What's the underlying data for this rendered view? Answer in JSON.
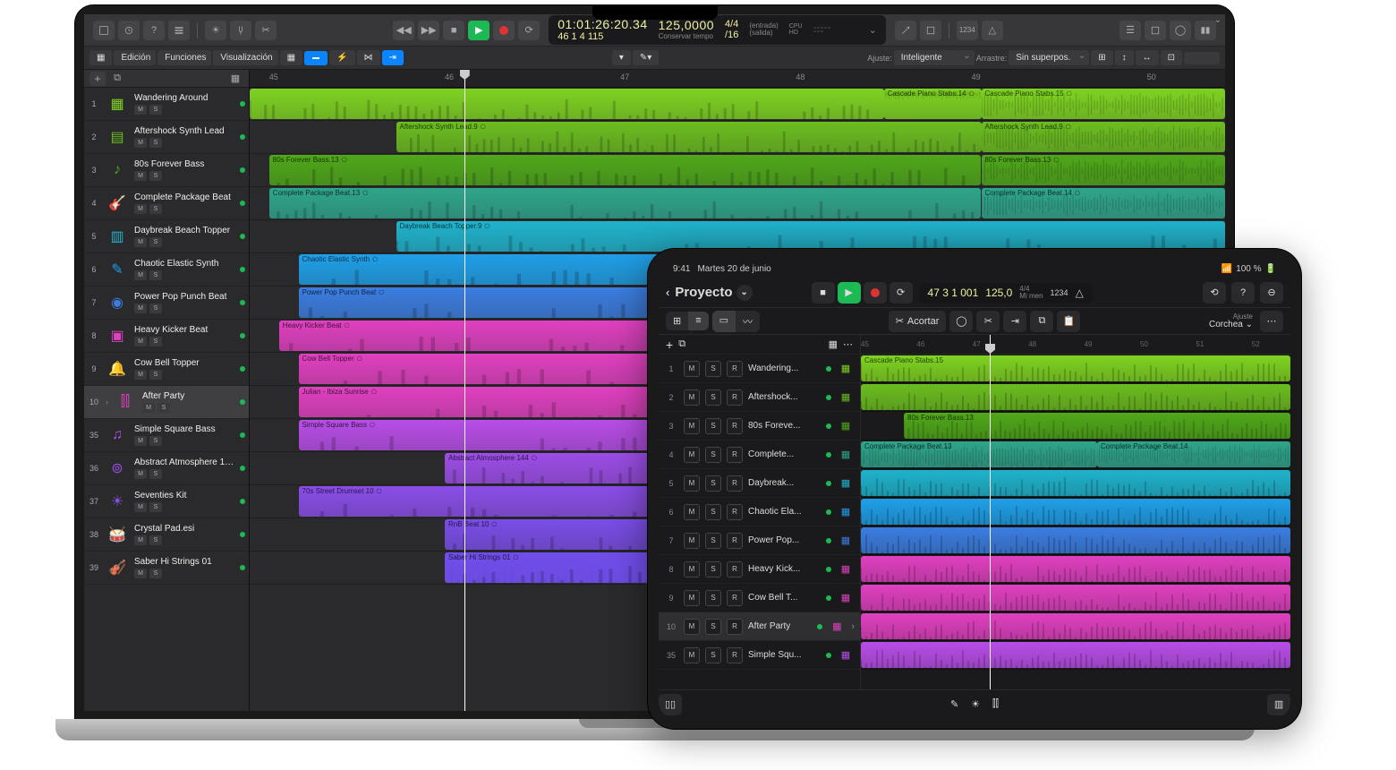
{
  "mac": {
    "toolbar": {
      "transport_lcd": {
        "timecode": "01:01:26:20.34",
        "position": "46 1 4 115",
        "tempo": "125,0000",
        "tempo_label": "Conservar tempo",
        "sig": "4/4",
        "sig_div": "/16",
        "in_label": "(entrada)",
        "out_label": "(salida)",
        "cpu": "CPU",
        "hd": "HD"
      },
      "right_label": "1234"
    },
    "menubar": {
      "edit": "Edición",
      "functions": "Funciones",
      "view": "Visualización",
      "snap_label": "Ajuste:",
      "snap_value": "Inteligente",
      "drag_label": "Arrastre:",
      "drag_value": "Sin superpos."
    },
    "ruler_marks": [
      "45",
      "46",
      "47",
      "48",
      "49",
      "50"
    ],
    "tracks": [
      {
        "num": "1",
        "name": "Wandering Around",
        "color": "#7ed321",
        "icon": "grid"
      },
      {
        "num": "2",
        "name": "Aftershock Synth Lead",
        "color": "#6bbd1f",
        "icon": "synth"
      },
      {
        "num": "3",
        "name": "80s Forever Bass",
        "color": "#4fa819",
        "icon": "bass"
      },
      {
        "num": "4",
        "name": "Complete Package Beat",
        "color": "#2fa58b",
        "icon": "guitar"
      },
      {
        "num": "5",
        "name": "Daybreak Beach Topper",
        "color": "#1fb3cc",
        "icon": "synth2"
      },
      {
        "num": "6",
        "name": "Chaotic Elastic Synth",
        "color": "#1f9fe8",
        "icon": "pencil"
      },
      {
        "num": "7",
        "name": "Power Pop Punch Beat",
        "color": "#3b7de0",
        "icon": "beat"
      },
      {
        "num": "8",
        "name": "Heavy Kicker Beat",
        "color": "#e040c0",
        "icon": "kick"
      },
      {
        "num": "9",
        "name": "Cow Bell Topper",
        "color": "#e040c0",
        "icon": "bell"
      },
      {
        "num": "10",
        "name": "After Party",
        "color": "#e040c0",
        "icon": "party",
        "selected": true
      },
      {
        "num": "35",
        "name": "Simple Square Bass",
        "color": "#b84de8",
        "icon": "sqbass"
      },
      {
        "num": "36",
        "name": "Abstract Atmosphere 144",
        "color": "#9c4de8",
        "icon": "atmo"
      },
      {
        "num": "37",
        "name": "Seventies Kit",
        "color": "#8a4de8",
        "icon": "kit"
      },
      {
        "num": "38",
        "name": "Crystal Pad.esi",
        "color": "#7a4de8",
        "icon": "drum"
      },
      {
        "num": "39",
        "name": "Saber Hi Strings 01",
        "color": "#6f4de8",
        "icon": "strings"
      }
    ],
    "regions": [
      {
        "lane": 0,
        "start": 0,
        "end": 65,
        "label": "",
        "color": "#7ed321"
      },
      {
        "lane": 0,
        "start": 65,
        "end": 75,
        "label": "Cascade Piano Stabs.14",
        "color": "#7ed321"
      },
      {
        "lane": 0,
        "start": 75,
        "end": 100,
        "label": "Cascade Piano Stabs.15",
        "color": "#7ed321"
      },
      {
        "lane": 1,
        "start": 15,
        "end": 75,
        "label": "Aftershock Synth Lead.9",
        "color": "#6bbd1f"
      },
      {
        "lane": 1,
        "start": 75,
        "end": 100,
        "label": "Aftershock Synth Lead.9",
        "color": "#6bbd1f"
      },
      {
        "lane": 2,
        "start": 2,
        "end": 75,
        "label": "80s Forever Bass.13",
        "color": "#4fa819"
      },
      {
        "lane": 2,
        "start": 75,
        "end": 100,
        "label": "80s Forever Bass.13",
        "color": "#4fa819"
      },
      {
        "lane": 3,
        "start": 2,
        "end": 75,
        "label": "Complete Package Beat.13",
        "color": "#2fa58b"
      },
      {
        "lane": 3,
        "start": 75,
        "end": 100,
        "label": "Complete Package Beat.14",
        "color": "#2fa58b"
      },
      {
        "lane": 4,
        "start": 15,
        "end": 100,
        "label": "Daybreak Beach Topper.9",
        "color": "#1fb3cc"
      },
      {
        "lane": 5,
        "start": 5,
        "end": 100,
        "label": "Chaotic Elastic Synth",
        "color": "#1f9fe8"
      },
      {
        "lane": 6,
        "start": 5,
        "end": 100,
        "label": "Power Pop Punch Beat",
        "color": "#3b7de0"
      },
      {
        "lane": 7,
        "start": 3,
        "end": 100,
        "label": "Heavy Kicker Beat",
        "color": "#e040c0"
      },
      {
        "lane": 8,
        "start": 5,
        "end": 100,
        "label": "Cow Bell Topper",
        "color": "#e040c0"
      },
      {
        "lane": 9,
        "start": 5,
        "end": 100,
        "label": "Julian - Ibiza Sunrise",
        "color": "#e040c0"
      },
      {
        "lane": 10,
        "start": 5,
        "end": 100,
        "label": "Simple Square Bass",
        "color": "#b84de8"
      },
      {
        "lane": 11,
        "start": 20,
        "end": 100,
        "label": "Abstract Atmosphere 144",
        "color": "#9c4de8"
      },
      {
        "lane": 12,
        "start": 5,
        "end": 100,
        "label": "70s Street Drumset 10",
        "color": "#8a4de8"
      },
      {
        "lane": 13,
        "start": 20,
        "end": 100,
        "label": "RnB Beat 10",
        "color": "#7a4de8"
      },
      {
        "lane": 14,
        "start": 20,
        "end": 75,
        "label": "Saber Hi Strings 01",
        "color": "#6f4de8"
      },
      {
        "lane": 14,
        "start": 20,
        "end": 100,
        "label2": "Saber Hi Strings 01",
        "color": "#6f4de8",
        "extra": true
      }
    ],
    "ms": {
      "m": "M",
      "s": "S"
    }
  },
  "ipad": {
    "status": {
      "time": "9:41",
      "date": "Martes 20 de junio",
      "battery": "100 %"
    },
    "header": {
      "back": "",
      "title": "Proyecto"
    },
    "transport_lcd": {
      "pos": "47 3 1 001",
      "tempo": "125,0",
      "sig": "4/4",
      "key": "Mi men",
      "disp": "1234"
    },
    "subheader": {
      "action": "Acortar",
      "snap_label": "Ajuste",
      "snap_value": "Corchea"
    },
    "ruler_marks": [
      "45",
      "46",
      "47",
      "48",
      "49",
      "50",
      "51",
      "52"
    ],
    "msr": {
      "m": "M",
      "s": "S",
      "r": "R"
    },
    "tracks": [
      {
        "num": "1",
        "name": "Wandering...",
        "color": "#7ed321"
      },
      {
        "num": "2",
        "name": "Aftershock...",
        "color": "#6bbd1f"
      },
      {
        "num": "3",
        "name": "80s Foreve...",
        "color": "#4fa819"
      },
      {
        "num": "4",
        "name": "Complete...",
        "color": "#2fa58b"
      },
      {
        "num": "5",
        "name": "Daybreak...",
        "color": "#1fb3cc"
      },
      {
        "num": "6",
        "name": "Chaotic Ela...",
        "color": "#1f9fe8"
      },
      {
        "num": "7",
        "name": "Power Pop...",
        "color": "#3b7de0"
      },
      {
        "num": "8",
        "name": "Heavy Kick...",
        "color": "#e040c0"
      },
      {
        "num": "9",
        "name": "Cow Bell T...",
        "color": "#e040c0"
      },
      {
        "num": "10",
        "name": "After Party",
        "color": "#e040c0",
        "selected": true
      },
      {
        "num": "35",
        "name": "Simple Squ...",
        "color": "#b84de8"
      }
    ],
    "regions": [
      {
        "lane": 0,
        "start": 0,
        "end": 100,
        "label": "Cascade Piano Stabs.15",
        "color": "#7ed321"
      },
      {
        "lane": 1,
        "start": 0,
        "end": 100,
        "label": "",
        "color": "#6bbd1f"
      },
      {
        "lane": 2,
        "start": 10,
        "end": 100,
        "label": "80s Forever Bass.13",
        "color": "#4fa819"
      },
      {
        "lane": 3,
        "start": 0,
        "end": 55,
        "label": "Complete Package Beat.13",
        "color": "#2fa58b"
      },
      {
        "lane": 3,
        "start": 55,
        "end": 100,
        "label": "Complete Package Beat.14",
        "color": "#2fa58b"
      },
      {
        "lane": 4,
        "start": 0,
        "end": 100,
        "label": "",
        "color": "#1fb3cc"
      },
      {
        "lane": 5,
        "start": 0,
        "end": 100,
        "label": "",
        "color": "#1f9fe8"
      },
      {
        "lane": 6,
        "start": 0,
        "end": 100,
        "label": "",
        "color": "#3b7de0"
      },
      {
        "lane": 7,
        "start": 0,
        "end": 100,
        "label": "",
        "color": "#e040c0"
      },
      {
        "lane": 8,
        "start": 0,
        "end": 100,
        "label": "",
        "color": "#e040c0"
      },
      {
        "lane": 9,
        "start": 0,
        "end": 100,
        "label": "",
        "color": "#e040c0"
      },
      {
        "lane": 10,
        "start": 0,
        "end": 100,
        "label": "",
        "color": "#b84de8"
      }
    ]
  }
}
